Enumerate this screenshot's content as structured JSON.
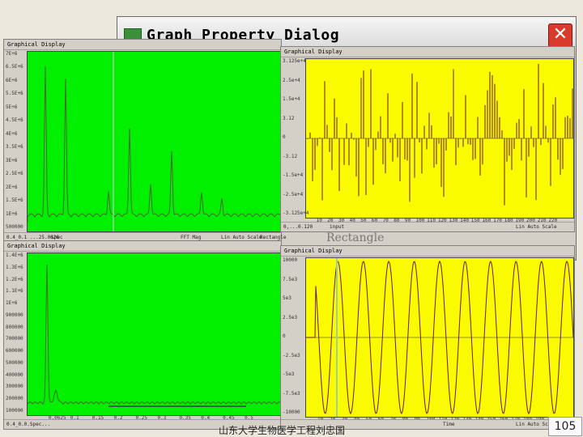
{
  "background_dialog": {
    "title": "Graph Property Dialog",
    "close_label": "✕",
    "obscured_field_text": "Rectangle"
  },
  "windows": {
    "top_left": {
      "title": "Graphical Display",
      "y_ticks": [
        "7E+6",
        "6.5E+6",
        "6E+6",
        "5.5E+6",
        "5E+6",
        "4.5E+6",
        "4E+6",
        "3.5E+6",
        "3E+6",
        "2.5E+6",
        "2E+6",
        "1.5E+6",
        "1E+6",
        "500000"
      ],
      "x_ticks": [
        "0.0625",
        "0.1",
        "0.2",
        "0.25",
        "0.3",
        "0.4",
        "0.45",
        "0.5"
      ],
      "status": [
        "0.4_0.1 ...25.0626",
        "spec",
        "FFT Mag",
        "Lin Auto Scale",
        "Rectangle"
      ]
    },
    "top_right": {
      "title": "Graphical Display",
      "y_ticks": [
        "3.125e+4",
        "2.5e+4",
        "1.5e+4",
        "3.12",
        "0",
        "-3.12",
        "-1.5e+4",
        "-2.5e+4",
        "-3.125e+4"
      ],
      "x_ticks": [
        "10",
        "20",
        "30",
        "40",
        "50",
        "60",
        "70",
        "80",
        "90",
        "100",
        "110",
        "120",
        "130",
        "140",
        "150",
        "160",
        "170",
        "180",
        "190",
        "200",
        "210",
        "220"
      ],
      "status": [
        "0,...0.120",
        "input",
        "Lin Auto Scale"
      ]
    },
    "bottom_left": {
      "title": "Graphical Display",
      "y_ticks": [
        "1.4E+6",
        "1.3E+6",
        "1.2E+6",
        "1.1E+6",
        "1E+6",
        "900000",
        "800000",
        "700000",
        "600000",
        "500000",
        "400000",
        "300000",
        "200000",
        "100000"
      ],
      "x_ticks": [
        "0.0625",
        "0.1",
        "0.15",
        "0.2",
        "0.25",
        "0.3",
        "0.35",
        "0.4",
        "0.45",
        "0.5"
      ],
      "status": [
        "0.4_0.0.Spec..."
      ]
    },
    "bottom_right": {
      "title": "Graphical Display",
      "y_ticks": [
        "10000",
        "7.5e3",
        "5e3",
        "2.5e3",
        "0",
        "-2.5e3",
        "-5e3",
        "-7.5e3",
        "-10000"
      ],
      "x_ticks": [
        "10",
        "20",
        "30",
        "40",
        "50",
        "60",
        "70",
        "80",
        "90",
        "100",
        "110",
        "120",
        "130",
        "140",
        "150",
        "160",
        "170",
        "180",
        "190",
        "200"
      ],
      "status": [
        "Time",
        "Lin Auto Scale"
      ]
    }
  },
  "footer": {
    "text": "山东大学生物医学工程刘忠国",
    "page": "105"
  },
  "colors": {
    "green_plot": "#00f000",
    "yellow_plot": "#fbfb00",
    "trace_dark": "#6a1a3a",
    "trace_olive": "#4a6a30",
    "cursor": "#9ad0a0"
  }
}
